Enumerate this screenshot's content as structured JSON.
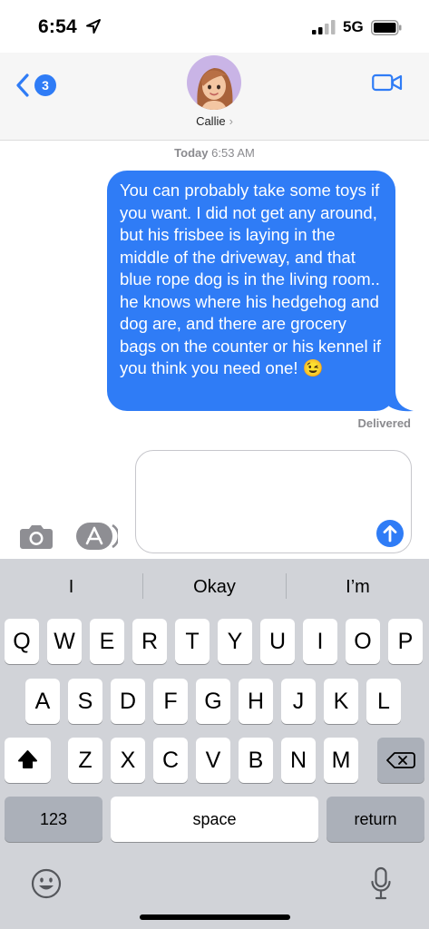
{
  "status_bar": {
    "time": "6:54",
    "network": "5G"
  },
  "nav": {
    "back_badge": "3",
    "contact_name": "Callie",
    "contact_chevron": "›"
  },
  "thread": {
    "timestamp_day": "Today",
    "timestamp_time": "6:53 AM",
    "messages": [
      {
        "from": "me",
        "text": "You can probably take some toys if you want. I did not get any around, but his frisbee is laying in the middle of the driveway, and that blue rope dog is in the living room.. he knows where his hedgehog and dog are, and there are grocery bags on the counter or his kennel if you think you need one! 😉"
      }
    ],
    "status": "Delivered"
  },
  "compose": {
    "value": ""
  },
  "keyboard": {
    "suggestions": [
      "I",
      "Okay",
      "I’m"
    ],
    "row1": [
      "Q",
      "W",
      "E",
      "R",
      "T",
      "Y",
      "U",
      "I",
      "O",
      "P"
    ],
    "row2": [
      "A",
      "S",
      "D",
      "F",
      "G",
      "H",
      "J",
      "K",
      "L"
    ],
    "row3": [
      "Z",
      "X",
      "C",
      "V",
      "B",
      "N",
      "M"
    ],
    "numbers_label": "123",
    "space_label": "space",
    "return_label": "return"
  },
  "colors": {
    "accent": "#2f7cf6",
    "keyboard_bg": "#d1d3d8"
  }
}
